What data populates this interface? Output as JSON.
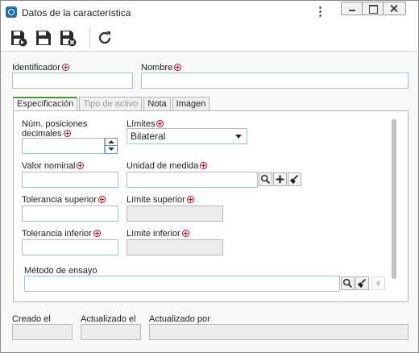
{
  "window": {
    "title": "Datos de la característica",
    "menu_icon": "kebab-menu-icon",
    "controls": [
      "minimize-icon",
      "maximize-icon",
      "close-icon"
    ]
  },
  "toolbar": {
    "buttons": [
      {
        "name": "save-new",
        "icon": "save-new-icon"
      },
      {
        "name": "save",
        "icon": "save-icon"
      },
      {
        "name": "save-close",
        "icon": "save-close-icon"
      },
      {
        "name": "refresh",
        "icon": "refresh-icon"
      }
    ]
  },
  "header_fields": {
    "identificador": {
      "label": "Identificador",
      "value": ""
    },
    "nombre": {
      "label": "Nombre",
      "value": ""
    }
  },
  "tabs": [
    {
      "label": "Especificación",
      "active": true,
      "disabled": false
    },
    {
      "label": "Tipo de activo",
      "active": false,
      "disabled": true
    },
    {
      "label": "Nota",
      "active": false,
      "disabled": false
    },
    {
      "label": "Imagen",
      "active": false,
      "disabled": false
    }
  ],
  "spec": {
    "num_pos_label_line1": "Núm. posiciones",
    "num_pos_label_line2": "decimales",
    "num_pos_value": "",
    "limites_label": "Límites",
    "limites_selected": "Bilateral",
    "valor_nominal_label": "Valor nominal",
    "valor_nominal_value": "",
    "unidad_label": "Unidad de medida",
    "unidad_value": "",
    "tol_sup_label": "Tolerancia superior",
    "tol_sup_value": "",
    "lim_sup_label": "Límite superior",
    "lim_sup_value": "",
    "tol_inf_label": "Tolerancia inferior",
    "tol_inf_value": "",
    "lim_inf_label": "Límite inferior",
    "lim_inf_value": "",
    "metodo_label": "Método de ensayo",
    "metodo_value": ""
  },
  "footer": {
    "creado_label": "Creado el",
    "creado_value": "",
    "actualizado_label": "Actualizado el",
    "actualizado_value": "",
    "actualizado_por_label": "Actualizado por",
    "actualizado_por_value": ""
  },
  "colors": {
    "required": "#d0021b",
    "active_tab_accent": "#3b9a3b",
    "input_border": "#a9bdd0"
  }
}
